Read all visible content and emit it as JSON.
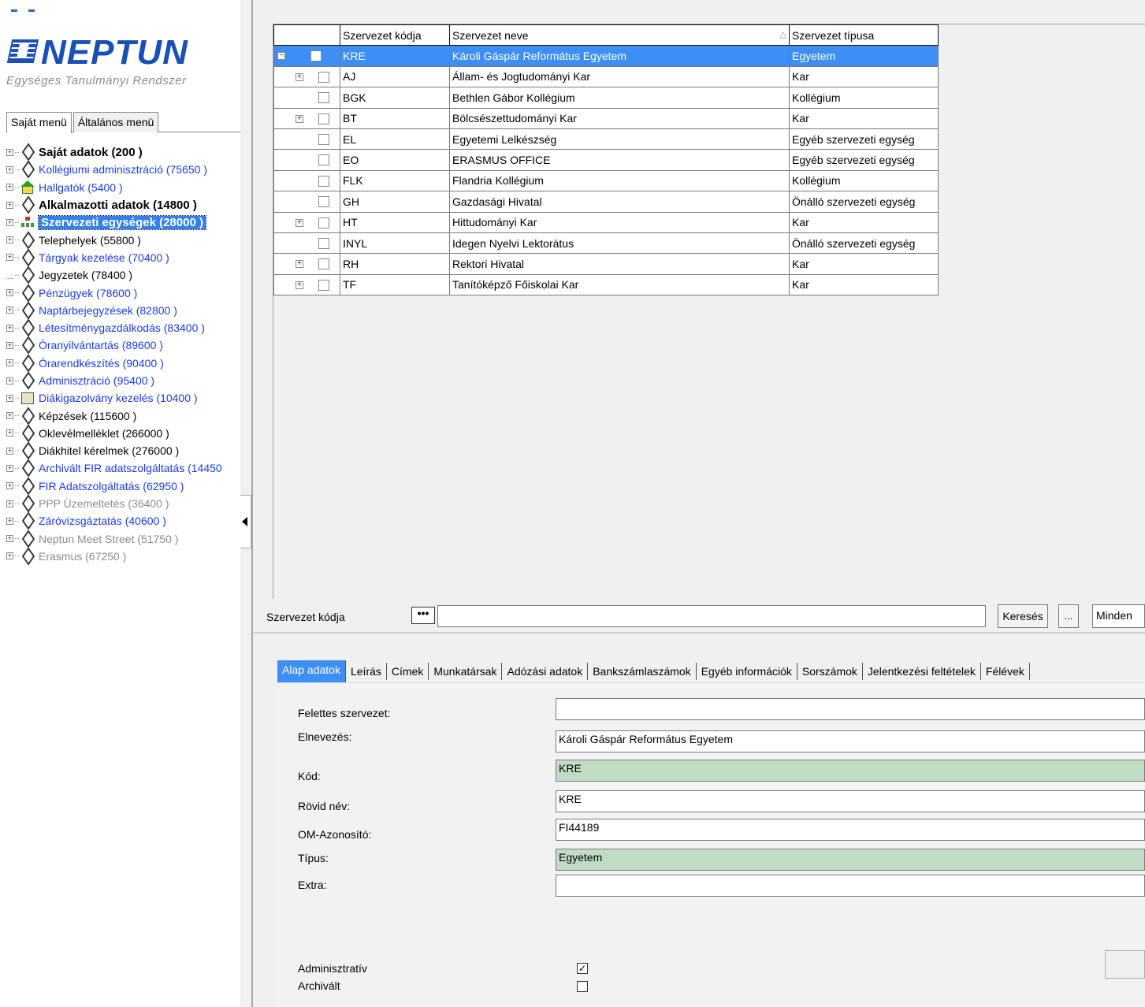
{
  "logo": {
    "name": "NEPTUN",
    "subtitle": "Egységes Tanulmányi Rendszer"
  },
  "menu_tabs": [
    "Saját menü",
    "Általános menü"
  ],
  "tree": [
    {
      "label": "Saját adatok (200  )",
      "style": "bold",
      "icon": "diamond",
      "exp": true
    },
    {
      "label": "Kollégiumi adminisztráció (75650  )",
      "style": "blue",
      "icon": "diamond",
      "exp": true
    },
    {
      "label": "Hallgatók (5400  )",
      "style": "blue",
      "icon": "house",
      "exp": true
    },
    {
      "label": "Alkalmazotti adatok (14800  )",
      "style": "bold",
      "icon": "diamond",
      "exp": true
    },
    {
      "label": "Szervezeti egységek (28000  )",
      "style": "selected",
      "icon": "org",
      "exp": true
    },
    {
      "label": "Telephelyek (55800  )",
      "style": "black",
      "icon": "diamond",
      "exp": true
    },
    {
      "label": "Tárgyak kezelése (70400  )",
      "style": "blue",
      "icon": "diamond",
      "exp": true
    },
    {
      "label": "Jegyzetek (78400  )",
      "style": "black",
      "icon": "diamond",
      "exp": false
    },
    {
      "label": "Pénzügyek (78600  )",
      "style": "blue",
      "icon": "diamond",
      "exp": true
    },
    {
      "label": "Naptárbejegyzések (82800  )",
      "style": "blue",
      "icon": "diamond",
      "exp": true
    },
    {
      "label": "Létesítménygazdálkodás (83400  )",
      "style": "blue",
      "icon": "diamond",
      "exp": true
    },
    {
      "label": "Óranyilvántartás (89600  )",
      "style": "blue",
      "icon": "diamond",
      "exp": true
    },
    {
      "label": "Órarendkészítés (90400  )",
      "style": "blue",
      "icon": "diamond",
      "exp": true
    },
    {
      "label": "Adminisztráció (95400  )",
      "style": "blue",
      "icon": "diamond",
      "exp": true
    },
    {
      "label": "Diákigazolvány kezelés (10400  )",
      "style": "blue",
      "icon": "card",
      "exp": true
    },
    {
      "label": "Képzések (115600  )",
      "style": "black",
      "icon": "diamond",
      "exp": true
    },
    {
      "label": "Oklevélmelléklet (266000  )",
      "style": "black",
      "icon": "diamond",
      "exp": true
    },
    {
      "label": "Diákhitel kérelmek (276000  )",
      "style": "black",
      "icon": "diamond",
      "exp": true
    },
    {
      "label": "Archivált FIR adatszolgáltatás (14450",
      "style": "blue",
      "icon": "diamond",
      "exp": true
    },
    {
      "label": "FIR Adatszolgáltatás (62950  )",
      "style": "blue",
      "icon": "diamond",
      "exp": true
    },
    {
      "label": "PPP Üzemeltetés (36400  )",
      "style": "grey",
      "icon": "diamond",
      "exp": true
    },
    {
      "label": "Záróvizsgáztatás (40600  )",
      "style": "blue",
      "icon": "diamond",
      "exp": true
    },
    {
      "label": "Neptun Meet Street (51750  )",
      "style": "grey",
      "icon": "diamond",
      "exp": true
    },
    {
      "label": "Erasmus (67250  )",
      "style": "grey",
      "icon": "diamond",
      "exp": true
    }
  ],
  "grid": {
    "columns": [
      "Szervezet kódja",
      "Szervezet neve",
      "Szervezet típusa"
    ],
    "sort_indicator": "△",
    "rows": [
      {
        "code": "KRE",
        "name": "Károli Gáspár Református Egyetem",
        "type": "Egyetem",
        "exp": "−",
        "selected": true
      },
      {
        "code": "AJ",
        "name": "Állam- és Jogtudományi Kar",
        "type": "Kar",
        "exp": "+",
        "selected": false
      },
      {
        "code": "BGK",
        "name": "Bethlen Gábor Kollégium",
        "type": "Kollégium",
        "exp": "",
        "selected": false
      },
      {
        "code": "BT",
        "name": "Bölcsészettudományi Kar",
        "type": "Kar",
        "exp": "+",
        "selected": false
      },
      {
        "code": "EL",
        "name": "Egyetemi Lelkészség",
        "type": "Egyéb szervezeti egység",
        "exp": "",
        "selected": false
      },
      {
        "code": "EO",
        "name": "ERASMUS OFFICE",
        "type": "Egyéb szervezeti egység",
        "exp": "",
        "selected": false
      },
      {
        "code": "FLK",
        "name": "Flandria Kollégium",
        "type": "Kollégium",
        "exp": "",
        "selected": false
      },
      {
        "code": "GH",
        "name": "Gazdasági Hivatal",
        "type": "Önálló szervezeti egység",
        "exp": "",
        "selected": false
      },
      {
        "code": "HT",
        "name": "Hittudományi Kar",
        "type": "Kar",
        "exp": "+",
        "selected": false
      },
      {
        "code": "INYL",
        "name": "Idegen Nyelvi Lektorátus",
        "type": "Önálló szervezeti egység",
        "exp": "",
        "selected": false
      },
      {
        "code": "RH",
        "name": "Rektori Hivatal",
        "type": "Kar",
        "exp": "+",
        "selected": false
      },
      {
        "code": "TF",
        "name": "Tanítóképző Főiskolai Kar",
        "type": "Kar",
        "exp": "+",
        "selected": false
      }
    ]
  },
  "search": {
    "label": "Szervezet kódja",
    "dots": "•••",
    "value": "",
    "button": "Keresés",
    "more": "...",
    "filter": "Minden"
  },
  "tabs": [
    "Alap adatok",
    "Leírás",
    "Címek",
    "Munkatársak",
    "Adózási adatok",
    "Bankszámlaszámok",
    "Egyéb információk",
    "Sorszámok",
    "Jelentkezési feltételek",
    "Félévek"
  ],
  "form": {
    "parent_label": "Felettes szervezet:",
    "parent_value": "",
    "name_label": "Elnevezés:",
    "name_value": "Károli Gáspár Református Egyetem",
    "code_label": "Kód:",
    "code_value": "KRE",
    "short_label": "Rövid név:",
    "short_value": "KRE",
    "om_label": "OM-Azonosító:",
    "om_value": "FI44189",
    "type_label": "Típus:",
    "type_value": "Egyetem",
    "extra_label": "Extra:",
    "extra_value": "",
    "admin_label": "Adminisztratív",
    "admin_checked": true,
    "archived_label": "Archivált",
    "archived_checked": false,
    "check_mark": "✓"
  },
  "colors": {
    "selection": "#3d8ef5",
    "readonly_field": "#c1dcc5",
    "link": "#1a3cf0",
    "logo": "#1a50b4"
  }
}
